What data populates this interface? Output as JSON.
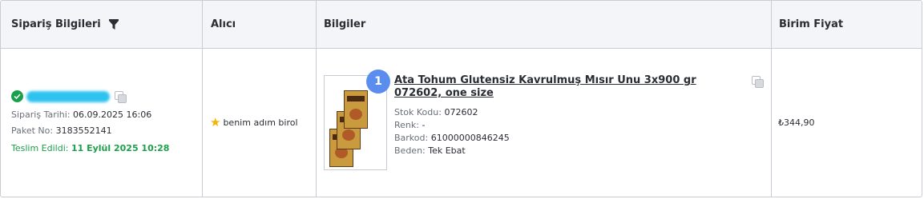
{
  "headers": {
    "order_info": "Sipariş Bilgileri",
    "buyer": "Alıcı",
    "info": "Bilgiler",
    "unit_price": "Birim Fiyat"
  },
  "order": {
    "date_label": "Sipariş Tarihi:",
    "date_value": "06.09.2025 16:06",
    "package_label": "Paket No:",
    "package_value": "3183552141",
    "delivered_label": "Teslim Edildi:",
    "delivered_value": "11 Eylül 2025 10:28"
  },
  "buyer": {
    "name": "benim adım birol"
  },
  "product": {
    "quantity": "1",
    "title": "Ata Tohum Glutensiz Kavrulmuş Mısır Unu 3x900 gr 072602, one size",
    "stock_label": "Stok Kodu:",
    "stock_value": "072602",
    "color_label": "Renk:",
    "color_value": "-",
    "barcode_label": "Barkod:",
    "barcode_value": "61000000846245",
    "size_label": "Beden:",
    "size_value": "Tek Ebat"
  },
  "price": {
    "value": "₺344,90"
  },
  "icons": {
    "filter": "filter-icon",
    "check": "check-circle-icon",
    "copy": "copy-icon",
    "star": "star-icon"
  },
  "colors": {
    "delivered": "#1aa04a",
    "badge": "#5b8def",
    "star": "#f4b400"
  }
}
